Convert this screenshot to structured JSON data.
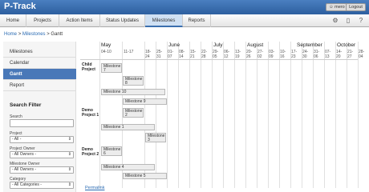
{
  "app": {
    "title": "P-Track",
    "user": "mero",
    "logout": "Logout"
  },
  "nav": {
    "tabs": [
      "Home",
      "Projects",
      "Action Items",
      "Status Updates",
      "Milestones",
      "Reports"
    ]
  },
  "breadcrumb": {
    "home": "Home",
    "milestones": "Milestones",
    "current": "Gantt",
    "sep": ">"
  },
  "sidebar": {
    "items": [
      "Milestones",
      "Calendar",
      "Gantt",
      "Report"
    ]
  },
  "filter": {
    "title": "Search Filter",
    "search_label": "Search",
    "search_value": "",
    "project_label": "Project",
    "project_value": "- All -",
    "owner_label": "Project Owner",
    "owner_value": "- All Owners -",
    "ms_owner_label": "Milestone Owner",
    "ms_owner_value": "- All Owners -",
    "category_label": "Category",
    "category_value": "- All Categories -"
  },
  "gantt": {
    "months": [
      "May",
      "June",
      "July",
      "August",
      "September",
      "October"
    ],
    "weeks": [
      "04-10",
      "11-17",
      "18-24",
      "25-31",
      "01-07",
      "08-14",
      "15-21",
      "22-28",
      "29-05",
      "06-12",
      "13-19",
      "20-26",
      "27-02",
      "03-09",
      "10-16",
      "17-23",
      "24-30",
      "31-06",
      "07-13",
      "14-20",
      "21-27",
      "28-04"
    ],
    "projects": [
      "Child Project",
      "Demo Project 1",
      "Demo Project 2"
    ],
    "milestones": [
      "Milestone 7",
      "Milestone 8",
      "Milestone 10",
      "Milestone 9",
      "Milestone 2",
      "Milestone 1",
      "Milestone 3",
      "Milestone 6",
      "Milestone 4",
      "Milestone 5"
    ]
  },
  "permalink": "Permalink"
}
